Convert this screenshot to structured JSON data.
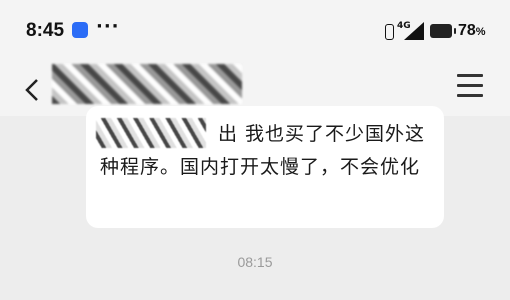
{
  "status_bar": {
    "time": "8:45",
    "notification_icons": [
      "baidu-icon"
    ],
    "overflow": "···",
    "network": "4G",
    "battery_percent": "78",
    "battery_suffix": "%"
  },
  "header": {
    "title": "",
    "back_icon": "back-icon",
    "menu_icon": "menu-icon"
  },
  "message": {
    "text": "出 我也买了不少国外这种程序。国内打开太慢了，不会优化"
  },
  "timestamp": "08:15",
  "colors": {
    "background": "#ededed",
    "bubble": "#ffffff",
    "timestamp": "#9a9a9a"
  }
}
